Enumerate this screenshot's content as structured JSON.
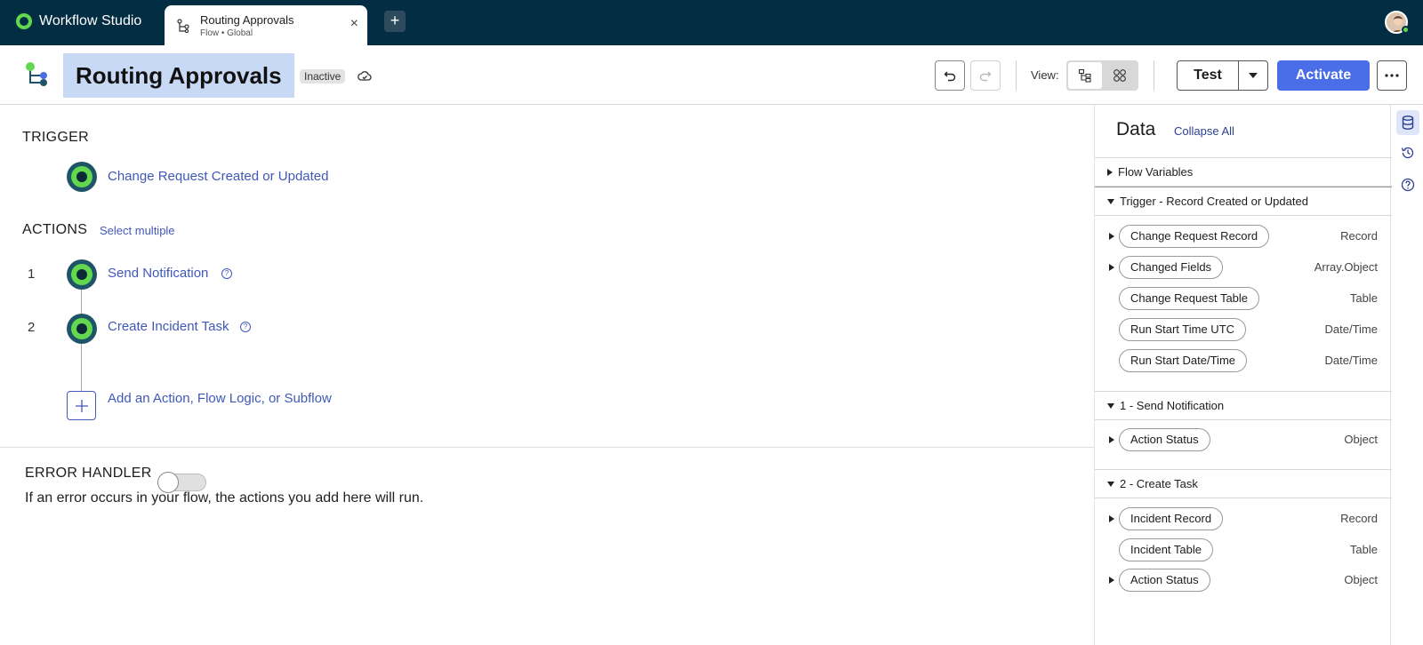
{
  "app": {
    "name": "Workflow Studio"
  },
  "tab": {
    "title": "Routing Approvals",
    "subtitle": "Flow • Global",
    "close": "×",
    "add": "+"
  },
  "header": {
    "title": "Routing Approvals",
    "status": "Inactive",
    "view_label": "View:",
    "test_label": "Test",
    "activate_label": "Activate"
  },
  "trigger": {
    "section": "TRIGGER",
    "label": "Change Request Created or Updated"
  },
  "actions": {
    "section": "ACTIONS",
    "select_multiple": "Select multiple",
    "steps": [
      {
        "num": "1",
        "label": "Send Notification"
      },
      {
        "num": "2",
        "label": "Create Incident Task"
      }
    ],
    "add_label": "Add an Action, Flow Logic, or Subflow"
  },
  "error_handler": {
    "label": "ERROR HANDLER",
    "description": "If an error occurs in your flow, the actions you add here will run.",
    "enabled": false
  },
  "data_panel": {
    "title": "Data",
    "collapse_all": "Collapse All",
    "groups": [
      {
        "label": "Flow Variables",
        "expanded": false
      },
      {
        "label": "Trigger - Record Created or Updated",
        "expanded": true,
        "items": [
          {
            "label": "Change Request Record",
            "type": "Record",
            "expandable": true
          },
          {
            "label": "Changed Fields",
            "type": "Array.Object",
            "expandable": true
          },
          {
            "label": "Change Request Table",
            "type": "Table",
            "expandable": false
          },
          {
            "label": "Run Start Time UTC",
            "type": "Date/Time",
            "expandable": false
          },
          {
            "label": "Run Start Date/Time",
            "type": "Date/Time",
            "expandable": false
          }
        ]
      },
      {
        "label": "1 - Send Notification",
        "expanded": true,
        "items": [
          {
            "label": "Action Status",
            "type": "Object",
            "expandable": true
          }
        ]
      },
      {
        "label": "2 - Create Task",
        "expanded": true,
        "items": [
          {
            "label": "Incident Record",
            "type": "Record",
            "expandable": true
          },
          {
            "label": "Incident Table",
            "type": "Table",
            "expandable": false
          },
          {
            "label": "Action Status",
            "type": "Object",
            "expandable": true
          }
        ]
      }
    ]
  },
  "colors": {
    "appbar": "#032d42",
    "accent": "#4a6ee8",
    "node_green": "#62d84e",
    "link": "#4158b8"
  }
}
